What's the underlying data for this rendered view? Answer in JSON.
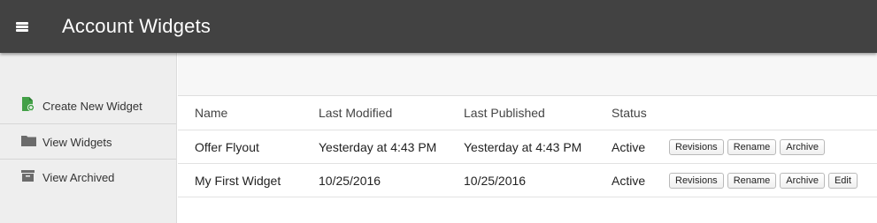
{
  "header": {
    "title": "Account Widgets",
    "menu_icon": "hamburger-menu-icon",
    "background": "#424242"
  },
  "sidebar": {
    "items": [
      {
        "label": "Create New Widget",
        "icon": "file-add-icon",
        "icon_color": "#43a047"
      },
      {
        "label": "View Widgets",
        "icon": "folder-icon",
        "icon_color": "#6b6b6b"
      },
      {
        "label": "View Archived",
        "icon": "archive-box-icon",
        "icon_color": "#6b6b6b"
      }
    ]
  },
  "table": {
    "columns": [
      "Name",
      "Last Modified",
      "Last Published",
      "Status"
    ],
    "rows": [
      {
        "name": "Offer Flyout",
        "last_modified": "Yesterday at 4:43 PM",
        "last_published": "Yesterday at 4:43 PM",
        "status": "Active",
        "actions": [
          "Revisions",
          "Rename",
          "Archive"
        ]
      },
      {
        "name": "My First Widget",
        "last_modified": "10/25/2016",
        "last_published": "10/25/2016",
        "status": "Active",
        "actions": [
          "Revisions",
          "Rename",
          "Archive",
          "Edit"
        ]
      }
    ]
  }
}
